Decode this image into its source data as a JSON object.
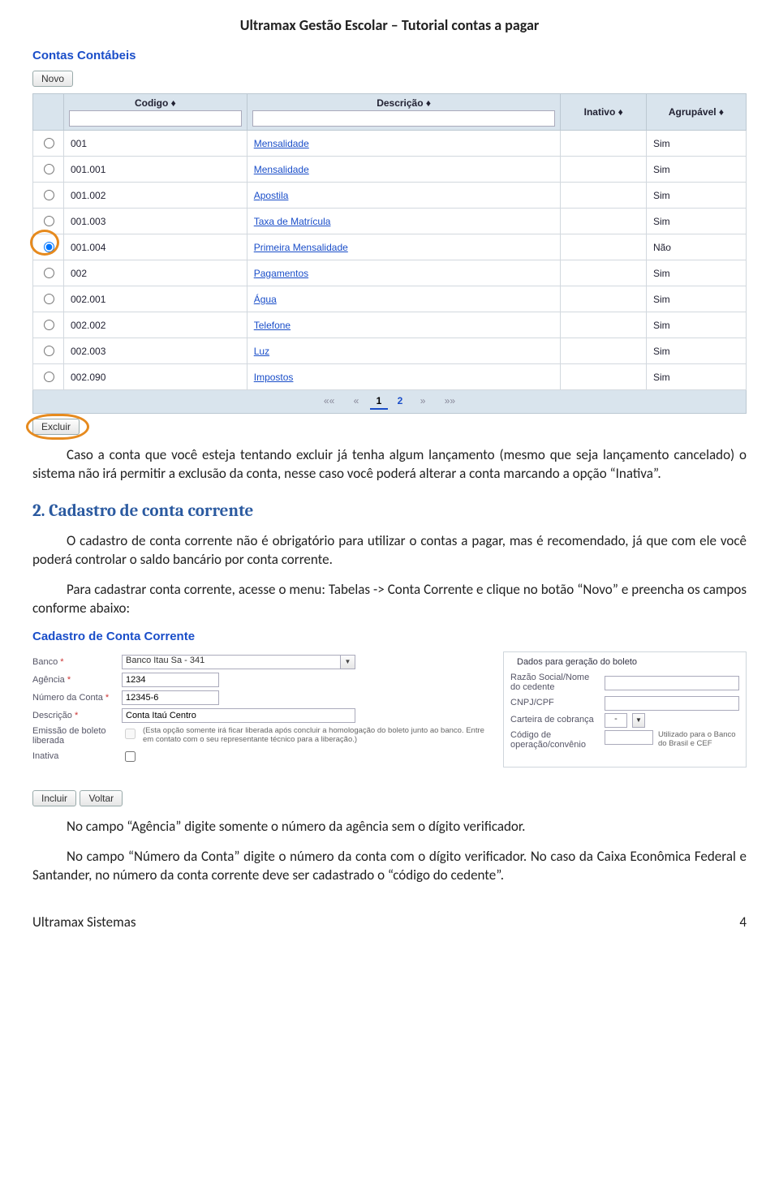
{
  "doc_header": "Ultramax Gestão Escolar – Tutorial contas a pagar",
  "shot1": {
    "title": "Contas Contábeis",
    "novo_btn": "Novo",
    "headers": {
      "codigo": "Codigo",
      "descricao": "Descrição",
      "inativo": "Inativo",
      "agrupavel": "Agrupável",
      "sort": "♦"
    },
    "rows": [
      {
        "codigo": "001",
        "descricao": "Mensalidade",
        "inativo": "",
        "agrupavel": "Sim",
        "selected": false
      },
      {
        "codigo": "001.001",
        "descricao": "Mensalidade",
        "inativo": "",
        "agrupavel": "Sim",
        "selected": false
      },
      {
        "codigo": "001.002",
        "descricao": "Apostila",
        "inativo": "",
        "agrupavel": "Sim",
        "selected": false
      },
      {
        "codigo": "001.003",
        "descricao": "Taxa de Matrícula",
        "inativo": "",
        "agrupavel": "Sim",
        "selected": false
      },
      {
        "codigo": "001.004",
        "descricao": "Primeira Mensalidade",
        "inativo": "",
        "agrupavel": "Não",
        "selected": true
      },
      {
        "codigo": "002",
        "descricao": "Pagamentos",
        "inativo": "",
        "agrupavel": "Sim",
        "selected": false
      },
      {
        "codigo": "002.001",
        "descricao": "Água",
        "inativo": "",
        "agrupavel": "Sim",
        "selected": false
      },
      {
        "codigo": "002.002",
        "descricao": "Telefone",
        "inativo": "",
        "agrupavel": "Sim",
        "selected": false
      },
      {
        "codigo": "002.003",
        "descricao": "Luz",
        "inativo": "",
        "agrupavel": "Sim",
        "selected": false
      },
      {
        "codigo": "002.090",
        "descricao": "Impostos",
        "inativo": "",
        "agrupavel": "Sim",
        "selected": false
      }
    ],
    "pager": {
      "first": "««",
      "prev": "«",
      "p1": "1",
      "p2": "2",
      "next": "»",
      "last": "»»"
    },
    "excluir_btn": "Excluir"
  },
  "body": {
    "p1": "Caso a conta que você esteja tentando excluir já tenha algum lançamento (mesmo que seja lançamento cancelado) o sistema não irá permitir a exclusão da conta, nesse caso você poderá alterar a conta marcando a opção “Inativa”.",
    "h2": "2. Cadastro de conta corrente",
    "p2": "O cadastro de conta corrente não é obrigatório para utilizar o contas a pagar, mas é recomendado, já que com ele você poderá controlar o saldo bancário por conta corrente.",
    "p3": "Para cadastrar conta corrente, acesse o menu: Tabelas -> Conta Corrente e clique no botão “Novo” e preencha os campos conforme abaixo:",
    "p4": "No campo “Agência” digite somente o número da agência sem o dígito verificador.",
    "p5": "No campo “Número da Conta” digite o número da conta com o dígito verificador. No caso da Caixa Econômica Federal e Santander, no número da conta corrente deve ser cadastrado o “código do cedente”."
  },
  "shot2": {
    "title": "Cadastro de Conta Corrente",
    "labels": {
      "banco": "Banco",
      "agencia": "Agência",
      "numero": "Número da Conta",
      "descricao": "Descrição",
      "emissao": "Emissão de boleto liberada",
      "inativa": "Inativa",
      "ast": "*"
    },
    "values": {
      "banco": "Banco Itau Sa - 341",
      "agencia": "1234",
      "numero": "12345-6",
      "descricao": "Conta Itaú Centro",
      "emissao_note": "(Esta opção somente irá ficar liberada após concluir a homologação do boleto junto ao banco. Entre em contato com o seu representante técnico para a liberação.)"
    },
    "boleto_box": {
      "title": "Dados para geração do boleto",
      "razao": "Razão Social/Nome do cedente",
      "cnpj": "CNPJ/CPF",
      "carteira": "Carteira de cobrança",
      "carteira_val": "-",
      "codigo": "Código de operação/convênio",
      "util": "Utilizado para o Banco do Brasil e CEF"
    },
    "incluir_btn": "Incluir",
    "voltar_btn": "Voltar"
  },
  "footer": {
    "left": "Ultramax Sistemas",
    "right": "4"
  }
}
